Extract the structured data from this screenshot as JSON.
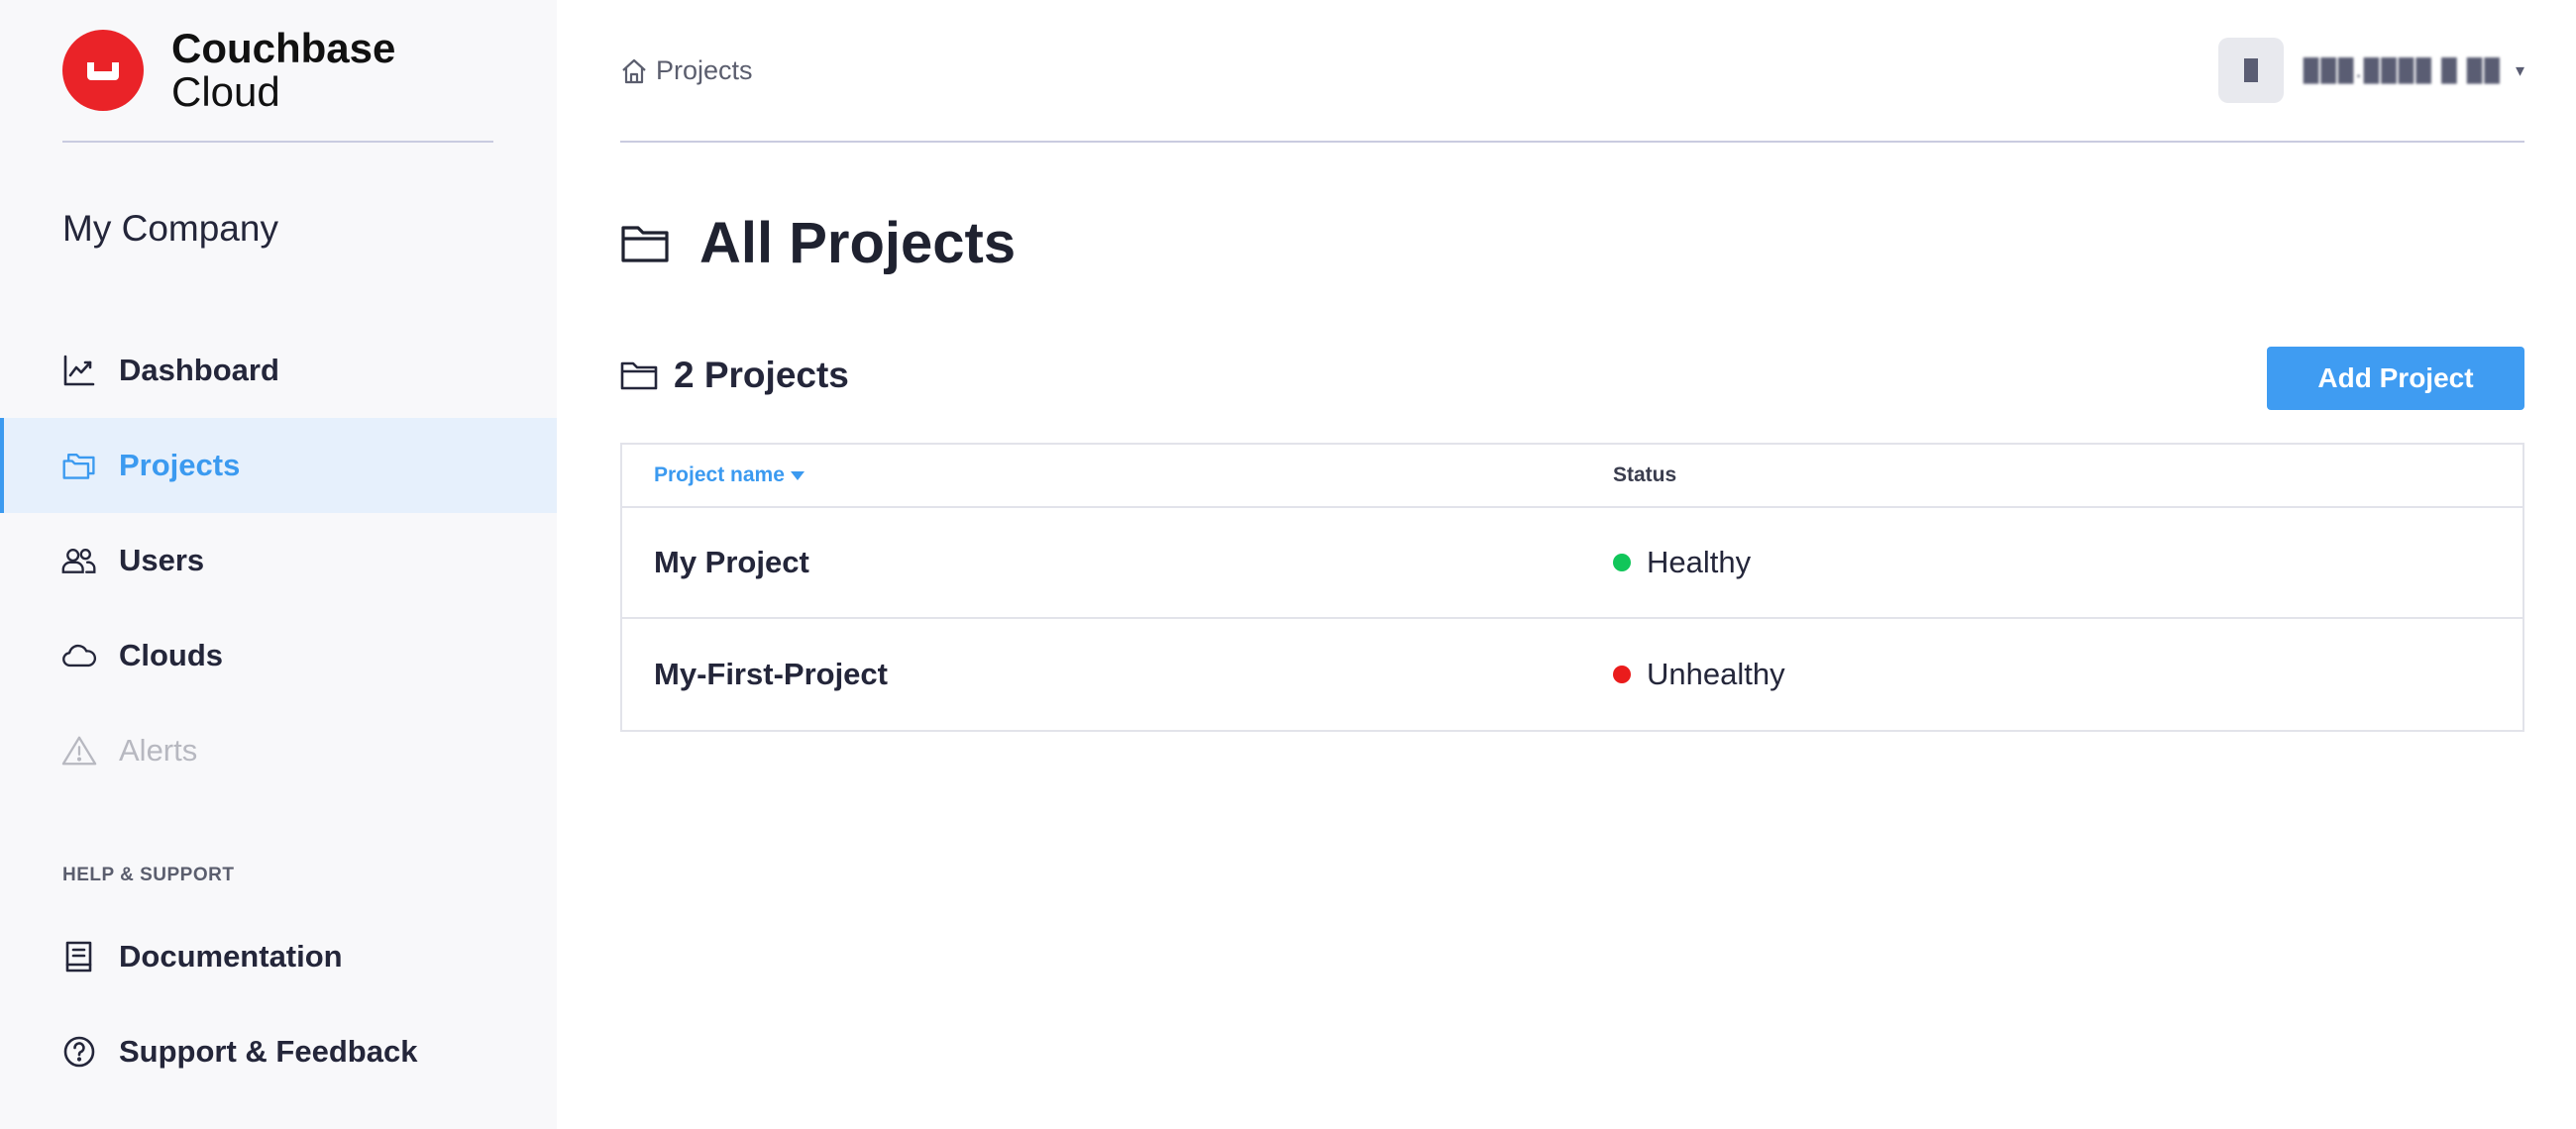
{
  "brand": {
    "name_line1": "Couchbase",
    "name_line2": "Cloud",
    "logo_color": "#ea2328"
  },
  "sidebar": {
    "company": "My Company",
    "items": [
      {
        "label": "Dashboard",
        "icon": "chart-line-icon",
        "state": "normal"
      },
      {
        "label": "Projects",
        "icon": "folders-icon",
        "state": "active"
      },
      {
        "label": "Users",
        "icon": "users-icon",
        "state": "normal"
      },
      {
        "label": "Clouds",
        "icon": "cloud-icon",
        "state": "normal"
      },
      {
        "label": "Alerts",
        "icon": "warning-icon",
        "state": "disabled"
      }
    ],
    "help_label": "HELP & SUPPORT",
    "help_items": [
      {
        "label": "Documentation",
        "icon": "book-icon"
      },
      {
        "label": "Support & Feedback",
        "icon": "question-circle-icon"
      }
    ]
  },
  "header": {
    "breadcrumb": "Projects",
    "user_name": "███.████ █ ██"
  },
  "main": {
    "title": "All Projects",
    "projects_count": "2 Projects",
    "add_button": "Add Project",
    "table": {
      "columns": [
        "Project name",
        "Status"
      ],
      "rows": [
        {
          "name": "My Project",
          "status": "Healthy",
          "status_color": "#11c65a"
        },
        {
          "name": "My-First-Project",
          "status": "Unhealthy",
          "status_color": "#ea1c1c"
        }
      ]
    }
  },
  "colors": {
    "accent": "#3b9af0",
    "active_bg": "#e6f0fc",
    "button": "#3f9cf2"
  }
}
